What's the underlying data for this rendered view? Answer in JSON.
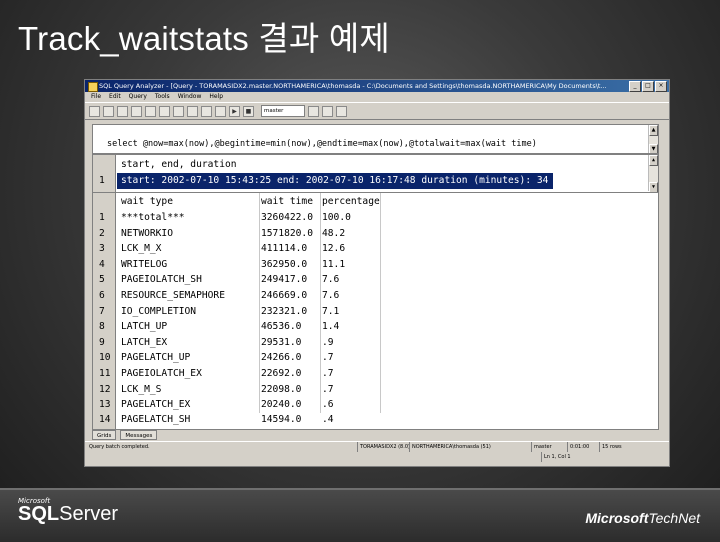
{
  "slide": {
    "title": "Track_waitstats 결과 예제",
    "logo_left_brand": "Microsoft",
    "logo_left_product_bold": "SQL",
    "logo_left_product": "Server",
    "logo_right_brand": "Microsoft",
    "logo_right_product": "TechNet"
  },
  "window": {
    "title": "SQL Query Analyzer - [Query - TORAMASIDX2.master.NORTHAMERICA\\thomasda - C:\\Documents and Settings\\thomasda.NORTHAMERICA\\My Documents\\t...",
    "menu": [
      "File",
      "Edit",
      "Query",
      "Tools",
      "Window",
      "Help"
    ],
    "database_select": "master",
    "query_text": "select @now=max(now),@begintime=min(now),@endtime=max(now),@totalwait=max(wait time)"
  },
  "results": {
    "set1": {
      "header": "start, end, duration",
      "rows": [
        {
          "num": "1",
          "text": "start: 2002-07-10 15:43:25 end: 2002-07-10 16:17:48 duration (minutes): 34"
        }
      ]
    },
    "set2": {
      "columns": [
        "wait type",
        "wait time",
        "percentage"
      ],
      "rows": [
        {
          "num": "1",
          "wait_type": "***total***",
          "wait_time": "3260422.0",
          "percentage": "100.0"
        },
        {
          "num": "2",
          "wait_type": "NETWORKIO",
          "wait_time": "1571820.0",
          "percentage": "48.2"
        },
        {
          "num": "3",
          "wait_type": "LCK_M_X",
          "wait_time": "411114.0",
          "percentage": "12.6"
        },
        {
          "num": "4",
          "wait_type": "WRITELOG",
          "wait_time": "362950.0",
          "percentage": "11.1"
        },
        {
          "num": "5",
          "wait_type": "PAGEIOLATCH_SH",
          "wait_time": "249417.0",
          "percentage": "7.6"
        },
        {
          "num": "6",
          "wait_type": "RESOURCE_SEMAPHORE",
          "wait_time": "246669.0",
          "percentage": "7.6"
        },
        {
          "num": "7",
          "wait_type": "IO_COMPLETION",
          "wait_time": "232321.0",
          "percentage": "7.1"
        },
        {
          "num": "8",
          "wait_type": "LATCH_UP",
          "wait_time": "46536.0",
          "percentage": "1.4"
        },
        {
          "num": "9",
          "wait_type": "LATCH_EX",
          "wait_time": "29531.0",
          "percentage": ".9"
        },
        {
          "num": "10",
          "wait_type": "PAGELATCH_UP",
          "wait_time": "24266.0",
          "percentage": ".7"
        },
        {
          "num": "11",
          "wait_type": "PAGEIOLATCH_EX",
          "wait_time": "22692.0",
          "percentage": ".7"
        },
        {
          "num": "12",
          "wait_type": "LCK_M_S",
          "wait_time": "22098.0",
          "percentage": ".7"
        },
        {
          "num": "13",
          "wait_type": "PAGELATCH_EX",
          "wait_time": "20240.0",
          "percentage": ".6"
        },
        {
          "num": "14",
          "wait_type": "PAGELATCH_SH",
          "wait_time": "14594.0",
          "percentage": ".4"
        }
      ]
    }
  },
  "tabs": [
    "Grids",
    "Messages"
  ],
  "status": {
    "text": "Query batch completed.",
    "server": "TORAMASIDX2 (8.0)",
    "user": "NORTHAMERICA\\thomasda (51)",
    "db": "master",
    "time": "0:01:00",
    "rows": "15 rows",
    "position": "Ln 1, Col 1"
  },
  "colors": {
    "selection": "#0a246a",
    "titlebar": "#0a246a",
    "chrome": "#d4d0c8"
  }
}
